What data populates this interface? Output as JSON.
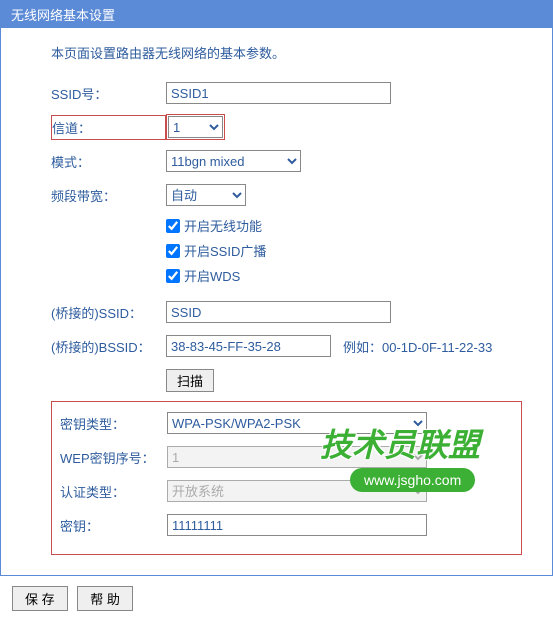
{
  "titleBar": "无线网络基本设置",
  "description": "本页面设置路由器无线网络的基本参数。",
  "ssid": {
    "label": "SSID号：",
    "value": "SSID1"
  },
  "channel": {
    "label": "信道：",
    "value": "1"
  },
  "mode": {
    "label": "模式：",
    "value": "11bgn mixed"
  },
  "bandwidth": {
    "label": "频段带宽：",
    "value": "自动"
  },
  "enableWireless": {
    "label": "开启无线功能",
    "checked": true
  },
  "enableSsidBroadcast": {
    "label": "开启SSID广播",
    "checked": true
  },
  "enableWds": {
    "label": "开启WDS",
    "checked": true
  },
  "bridgeSsid": {
    "label": "(桥接的)SSID：",
    "value": "SSID"
  },
  "bridgeBssid": {
    "label": "(桥接的)BSSID：",
    "value": "38-83-45-FF-35-28",
    "example": "例如：00-1D-0F-11-22-33"
  },
  "scanBtn": "扫描",
  "keyType": {
    "label": "密钥类型：",
    "value": "WPA-PSK/WPA2-PSK"
  },
  "wepIndex": {
    "label": "WEP密钥序号：",
    "value": "1"
  },
  "authType": {
    "label": "认证类型：",
    "value": "开放系统"
  },
  "key": {
    "label": "密钥：",
    "value": "11111111"
  },
  "saveBtn": "保 存",
  "helpBtn": "帮 助",
  "watermark": {
    "text": "技术员联盟",
    "url": "www.jsgho.com"
  }
}
